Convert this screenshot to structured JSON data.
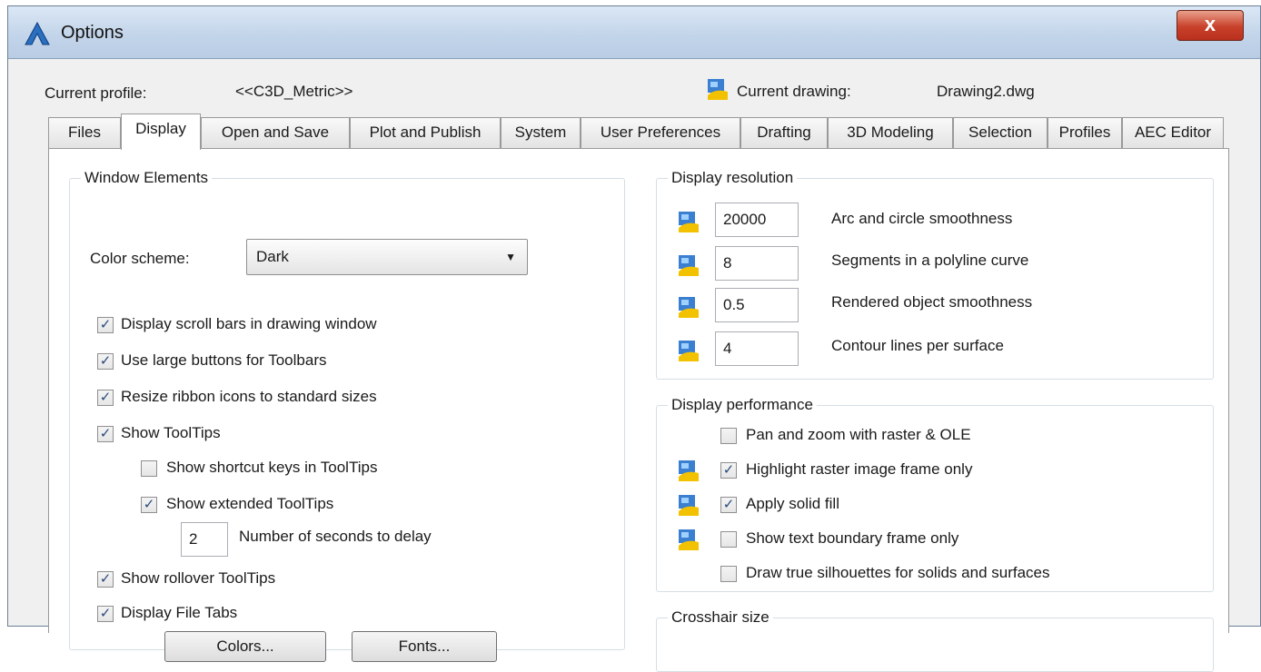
{
  "window": {
    "title": "Options",
    "close_glyph": "x"
  },
  "header": {
    "profile_label": "Current profile:",
    "profile_value": "<<C3D_Metric>>",
    "drawing_label": "Current drawing:",
    "drawing_value": "Drawing2.dwg"
  },
  "tabs": [
    "Files",
    "Display",
    "Open and Save",
    "Plot and Publish",
    "System",
    "User Preferences",
    "Drafting",
    "3D Modeling",
    "Selection",
    "Profiles",
    "AEC Editor"
  ],
  "active_tab": "Display",
  "window_elements": {
    "title": "Window Elements",
    "color_scheme_label": "Color scheme:",
    "color_scheme_value": "Dark",
    "checkboxes": [
      {
        "label": "Display scroll bars in drawing window",
        "checked": true
      },
      {
        "label": "Use large buttons for Toolbars",
        "checked": true
      },
      {
        "label": "Resize ribbon icons to standard sizes",
        "checked": true
      },
      {
        "label": "Show ToolTips",
        "checked": true
      },
      {
        "label": "Show shortcut keys in ToolTips",
        "checked": false
      },
      {
        "label": "Show extended ToolTips",
        "checked": true
      },
      {
        "label": "Show rollover ToolTips",
        "checked": true
      },
      {
        "label": "Display File Tabs",
        "checked": true
      }
    ],
    "delay_value": "2",
    "delay_label": "Number of seconds to delay",
    "colors_button": "Colors...",
    "fonts_button": "Fonts..."
  },
  "display_resolution": {
    "title": "Display resolution",
    "rows": [
      {
        "value": "20000",
        "label": "Arc and circle smoothness"
      },
      {
        "value": "8",
        "label": "Segments in a polyline curve"
      },
      {
        "value": "0.5",
        "label": "Rendered object smoothness"
      },
      {
        "value": "4",
        "label": "Contour lines per surface"
      }
    ]
  },
  "display_performance": {
    "title": "Display performance",
    "rows": [
      {
        "label": "Pan and zoom with raster & OLE",
        "checked": false
      },
      {
        "label": "Highlight raster image frame only",
        "checked": true
      },
      {
        "label": "Apply solid fill",
        "checked": true
      },
      {
        "label": "Show text boundary frame only",
        "checked": false
      },
      {
        "label": "Draw true silhouettes for solids and surfaces",
        "checked": false
      }
    ]
  },
  "crosshair": {
    "title": "Crosshair size"
  },
  "check_glyph": "✓",
  "dropdown_glyph": "▼"
}
